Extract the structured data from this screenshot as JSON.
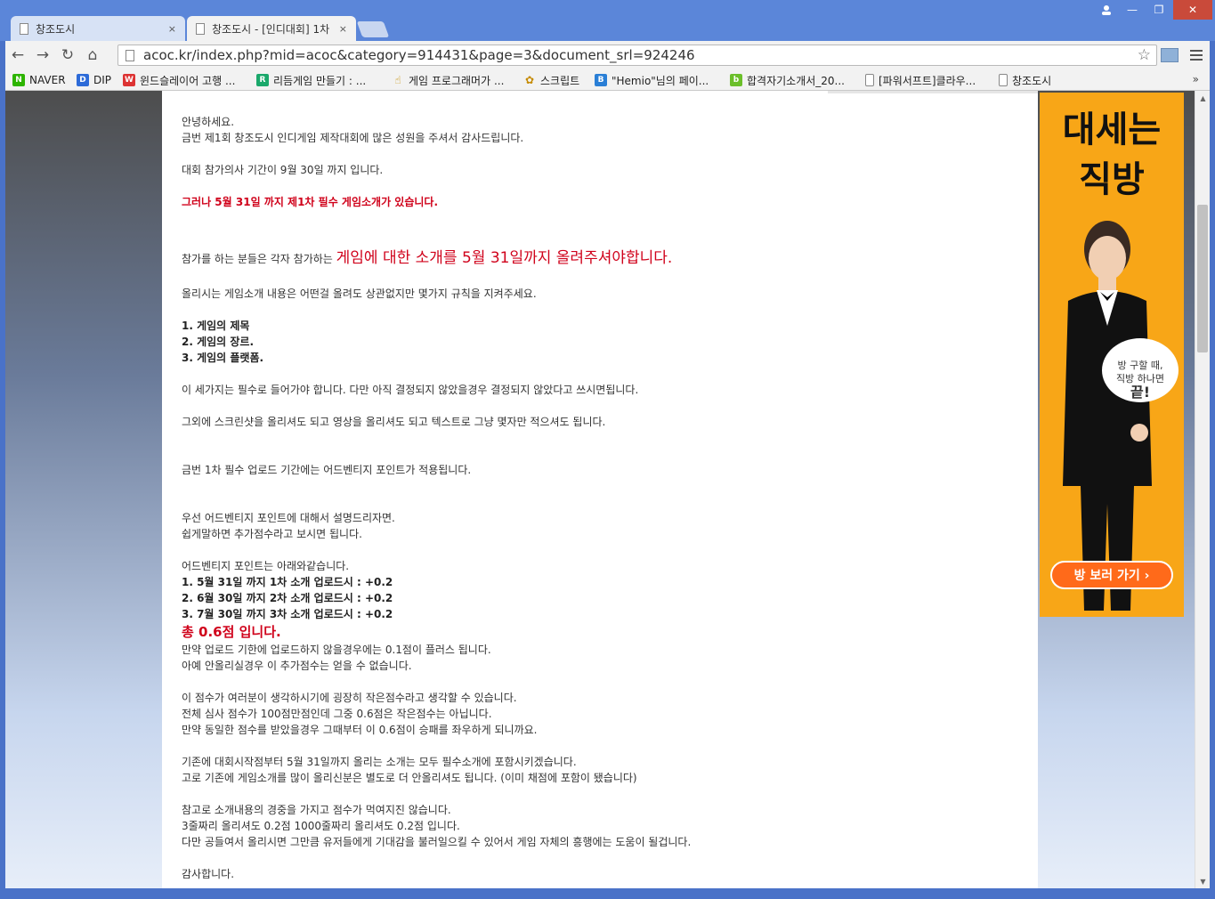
{
  "tabs": [
    {
      "label": "창조도시",
      "close": "×"
    },
    {
      "label": "창조도시 - [인디대회] 1차",
      "close": "×"
    }
  ],
  "window_controls": {
    "minimize": "—",
    "maximize": "❐",
    "close": "✕"
  },
  "toolbar": {
    "back": "←",
    "forward": "→",
    "reload": "↻",
    "home": "⌂",
    "star": "☆"
  },
  "address": {
    "url": "acoc.kr/index.php?mid=acoc&category=914431&page=3&document_srl=924246"
  },
  "bookmarks": [
    {
      "label": "NAVER",
      "icon": "N"
    },
    {
      "label": "DIP",
      "icon": "D"
    },
    {
      "label": "윈드슬레이어 고행 ...",
      "icon": "W"
    },
    {
      "label": "리듬게임 만들기 : ...",
      "icon": "R"
    },
    {
      "label": "게임 프로그래머가 ...",
      "icon": "☝"
    },
    {
      "label": "스크립트",
      "icon": "✿"
    },
    {
      "label": "\"Hemio\"님의 페이...",
      "icon": "B"
    },
    {
      "label": "합격자기소개서_20...",
      "icon": "b"
    },
    {
      "label": "[파워서프트]클라우...",
      "icon": ""
    },
    {
      "label": "창조도시",
      "icon": ""
    }
  ],
  "bookmarks_more": "»",
  "article": {
    "greeting": "안녕하세요.",
    "thanks": "금번 제1회 창조도시 인디게임 제작대회에 많은 성원을 주셔서 감사드립니다.",
    "period": "대회 참가의사 기간이 9월 30일 까지 입니다.",
    "notice_red": "그러나 5월 31일 까지 제1차 필수 게임소개가 있습니다.",
    "request_prefix": "참가를 하는 분들은 각자 참가하는 ",
    "request_big": "게임에 대한 소개를 5월 31일까지 올려주셔야합니다.",
    "rules_intro": "올리시는 게임소개 내용은 어떤걸 올려도 상관없지만 몇가지 규칙을 지켜주세요.",
    "rule1": "1. 게임의 제목",
    "rule2": "2. 게임의 장르.",
    "rule3": "3. 게임의 플랫폼.",
    "rules_note": "이 세가지는 필수로 들어가야 합니다. 다만 아직 결정되지 않았을경우 결정되지 않았다고 쓰시면됩니다.",
    "extras": "그외에 스크린샷을 올리셔도 되고 영상을 올리셔도 되고 텍스트로 그냥 몇자만 적으셔도 됩니다.",
    "advantage": "금번 1차 필수 업로드 기간에는 어드벤티지 포인트가 적용됩니다.",
    "explain1": "우선 어드벤티지 포인트에 대해서 설명드리자면.",
    "explain2": "쉽게말하면 추가점수라고 보시면 됩니다.",
    "points_intro": "어드벤티지 포인트는 아래와같습니다.",
    "point1": "1. 5월 31일 까지 1차 소개 업로드시 : +0.2",
    "point2": "2. 6월 30일 까지 2차 소개 업로드시 : +0.2",
    "point3": "3. 7월 30일 까지 3차 소개 업로드시 : +0.2",
    "total": "총 0.6점 입니다.",
    "late": "만약 업로드 기한에 업로드하지 않을경우에는 0.1점이 플러스 됩니다.",
    "none": "아예 안올리실경우 이 추가점수는 얻을 수 없습니다.",
    "score1": "이 점수가 여러분이 생각하시기에 굉장히 작은점수라고 생각할 수 있습니다.",
    "score2": "전체 심사 점수가 100점만점인데 그중 0.6점은 작은점수는 아닙니다.",
    "score3": "만약 동일한 점수를 받았을경우 그때부터 이 0.6점이 승패를 좌우하게 되니까요.",
    "existing1": "기존에 대회시작점부터 5월 31일까지 올리는 소개는 모두 필수소개에 포함시키겠습니다.",
    "existing2": "고로 기존에 게임소개를 많이 올리신분은 별도로 더 안올리셔도 됩니다. (이미 채점에 포함이 됐습니다)",
    "ref1": "참고로 소개내용의 경중을 가지고 점수가 먹여지진 않습니다.",
    "ref2": "3줄짜리 올리셔도 0.2점 1000줄짜리 올리셔도 0.2점 입니다.",
    "ref3": "다만 공들여서 올리시면 그만큼 유저들에게 기대감을 불러일으킬 수 있어서 게임 자체의 흥행에는 도움이 될겁니다.",
    "closing": "감사합니다."
  },
  "ad": {
    "headline": "대세는\n직방",
    "bubble_line": "방 구할 때,\n직방 하나면",
    "bubble_strong": "끝!",
    "button": "방 보러 가기 ›"
  },
  "scroll": {
    "up": "▲",
    "down": "▼"
  }
}
